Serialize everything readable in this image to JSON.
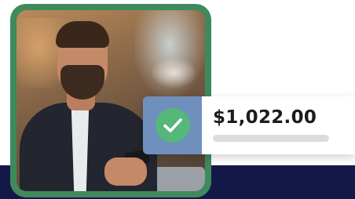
{
  "payment_card": {
    "amount": "$1,022.00",
    "status_icon": "check-icon"
  },
  "colors": {
    "photo_frame": "#3f8a5c",
    "icon_panel": "#6f8fbd",
    "check_circle": "#55b77a",
    "bottom_band": "#141849"
  }
}
